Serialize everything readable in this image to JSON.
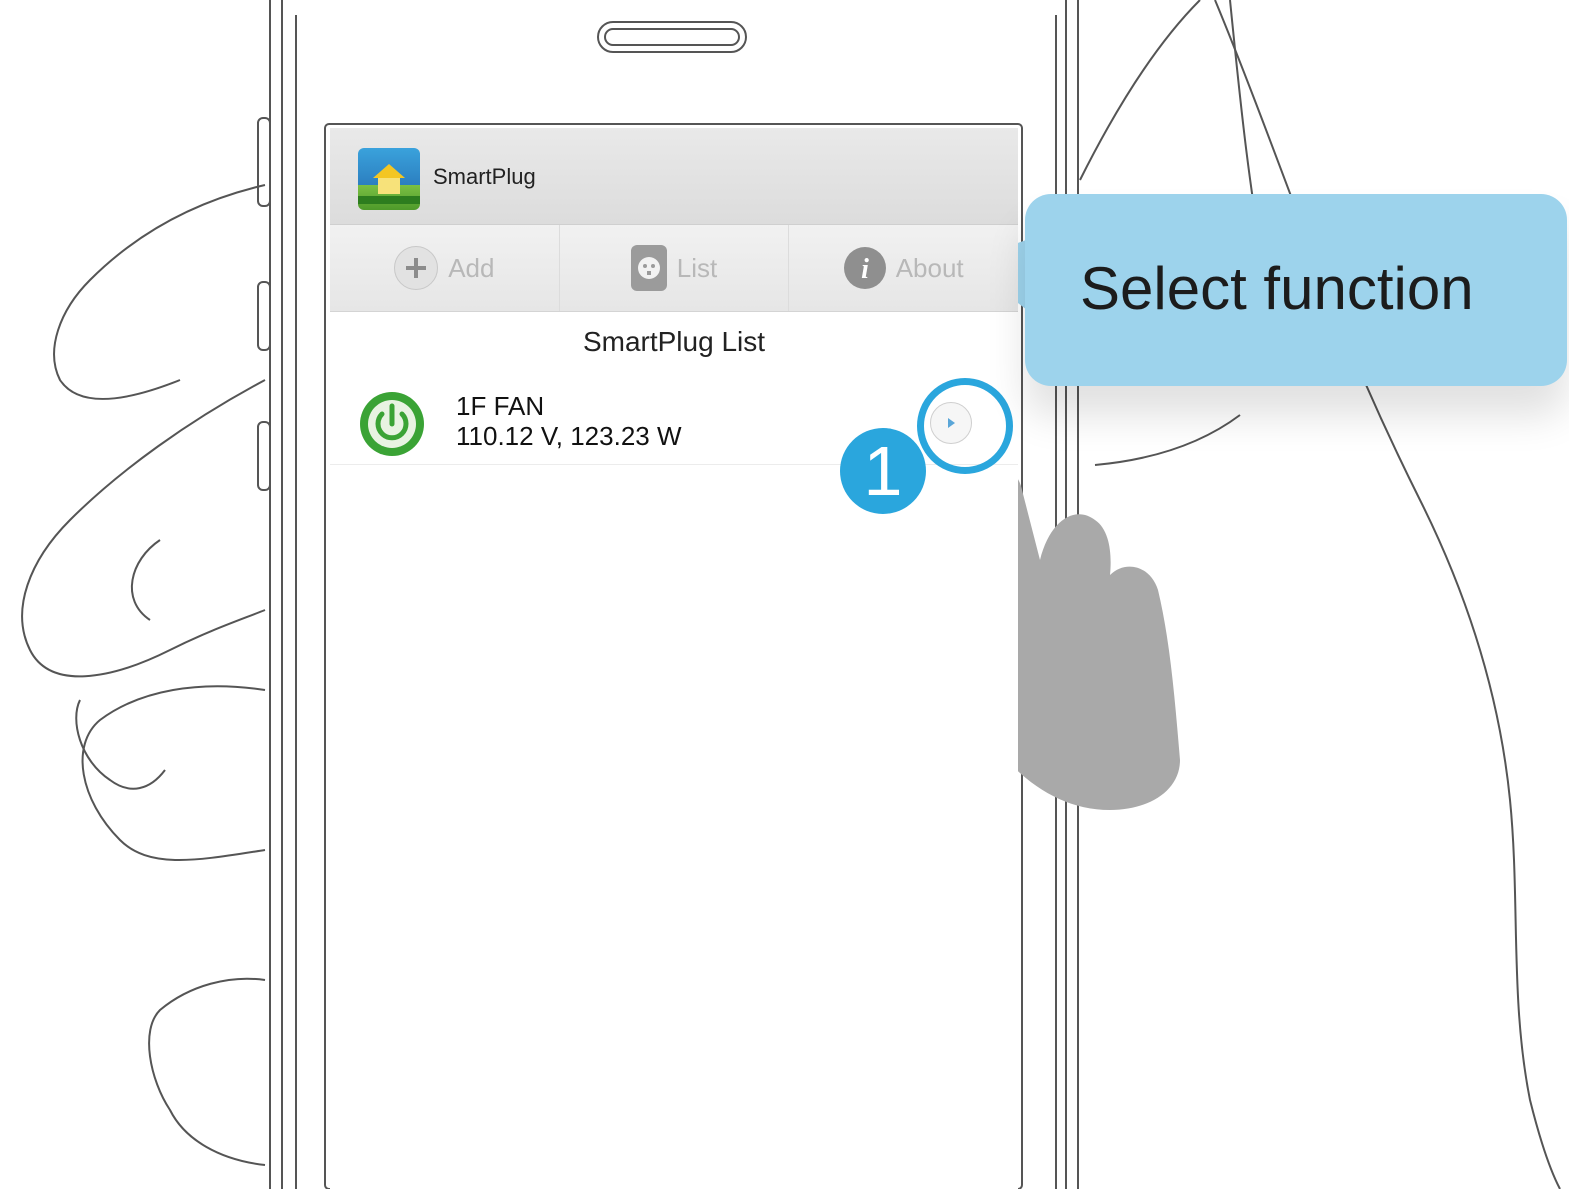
{
  "app": {
    "title": "SmartPlug"
  },
  "tabs": [
    {
      "label": "Add",
      "icon": "plus-icon"
    },
    {
      "label": "List",
      "icon": "plug-icon"
    },
    {
      "label": "About",
      "icon": "info-icon"
    }
  ],
  "list": {
    "heading": "SmartPlug List",
    "items": [
      {
        "name": "1F FAN",
        "reading": "110.12 V, 123.23 W",
        "power_state": "on"
      }
    ]
  },
  "callout": {
    "text": "Select function"
  },
  "step": {
    "number": "1"
  },
  "colors": {
    "accent": "#2aa6dd",
    "callout": "#9dd3ec",
    "power_on": "#3aa335"
  }
}
